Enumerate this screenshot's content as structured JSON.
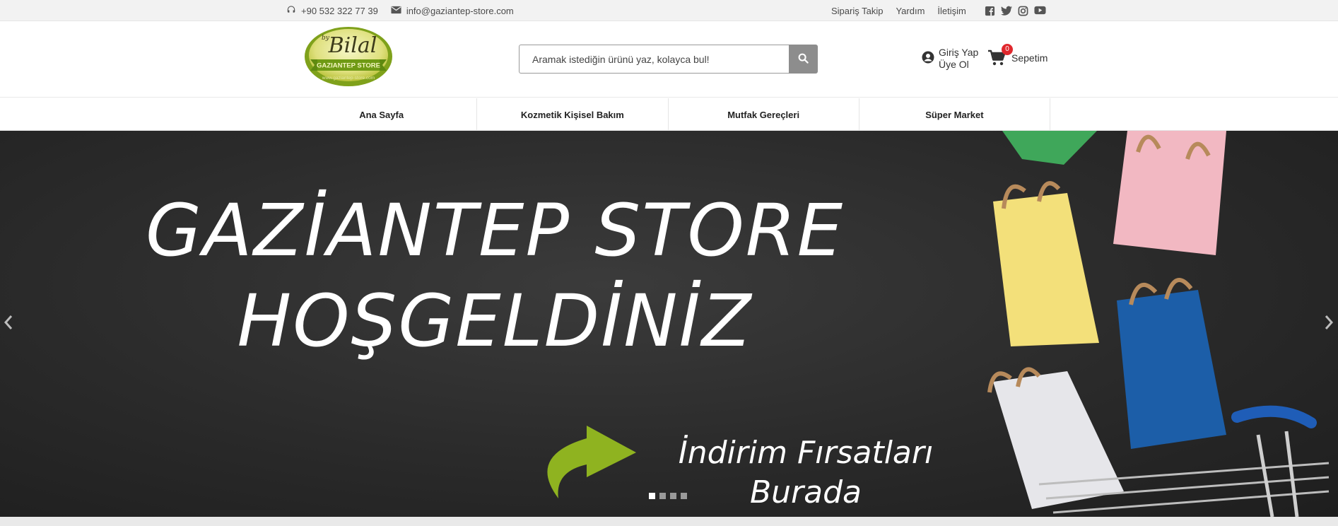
{
  "topbar": {
    "phone": "+90 532 322 77 39",
    "email": "info@gaziantep-store.com",
    "links": [
      "Sipariş Takip",
      "Yardım",
      "İletişim"
    ],
    "social_icons": [
      "facebook-icon",
      "twitter-icon",
      "instagram-icon",
      "youtube-icon"
    ]
  },
  "header": {
    "logo_name": "Bilal",
    "logo_by": "by",
    "logo_store": "GAZIANTEP STORE",
    "logo_url": "www.gaziantep-store.com",
    "search_placeholder": "Aramak istediğin ürünü yaz, kolayca bul!",
    "login_label": "Giriş Yap",
    "register_label": "Üye Ol",
    "cart_label": "Sepetim",
    "cart_count": "0"
  },
  "nav": {
    "items": [
      "Ana Sayfa",
      "Kozmetik Kişisel Bakım",
      "Mutfak Gereçleri",
      "Süper Market"
    ]
  },
  "banner": {
    "title_line1": "GAZİANTEP STORE",
    "title_line2": "HOŞGELDİNİZ",
    "sub_line1": "İndirim Fırsatları",
    "sub_line2": "Burada",
    "slide_count": 4,
    "active_slide": 1
  },
  "colors": {
    "badge": "#e0282d",
    "search_button": "#8d8d8d",
    "banner_bg": "#2a2a2a",
    "logo_green": "#7fa11b",
    "logo_yellow": "#e6e89a"
  }
}
